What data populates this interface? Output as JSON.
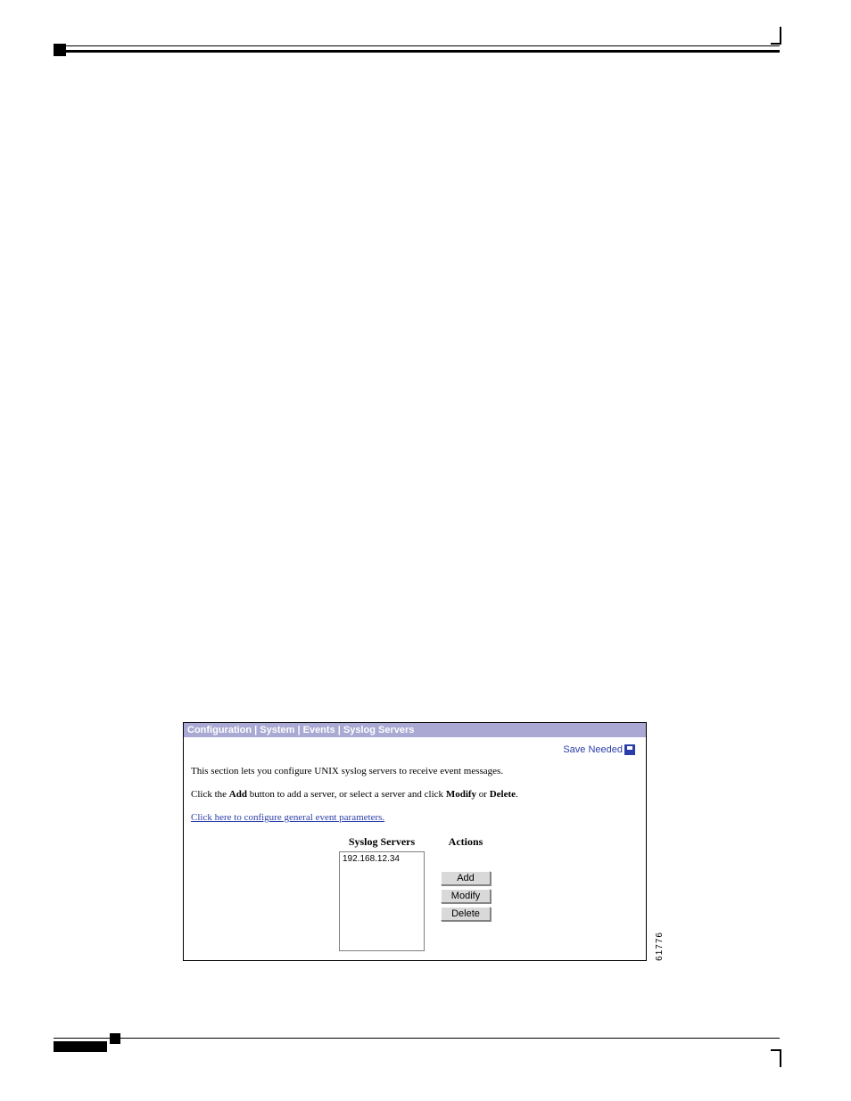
{
  "panel": {
    "breadcrumb": "Configuration | System | Events | Syslog Servers",
    "save_label": "Save Needed",
    "intro_text": "This section lets you configure UNIX syslog servers to receive event messages.",
    "instruction_prefix": "Click the ",
    "instruction_add": "Add",
    "instruction_mid": " button to add a server, or select a server and click ",
    "instruction_modify": "Modify",
    "instruction_or": " or ",
    "instruction_delete": "Delete",
    "instruction_suffix": ".",
    "general_link": "Click here to configure general event parameters.",
    "columns": {
      "servers": "Syslog Servers",
      "actions": "Actions"
    },
    "servers": [
      "192.168.12.34"
    ],
    "buttons": {
      "add": "Add",
      "modify": "Modify",
      "delete": "Delete"
    }
  },
  "figure_code": "61776"
}
